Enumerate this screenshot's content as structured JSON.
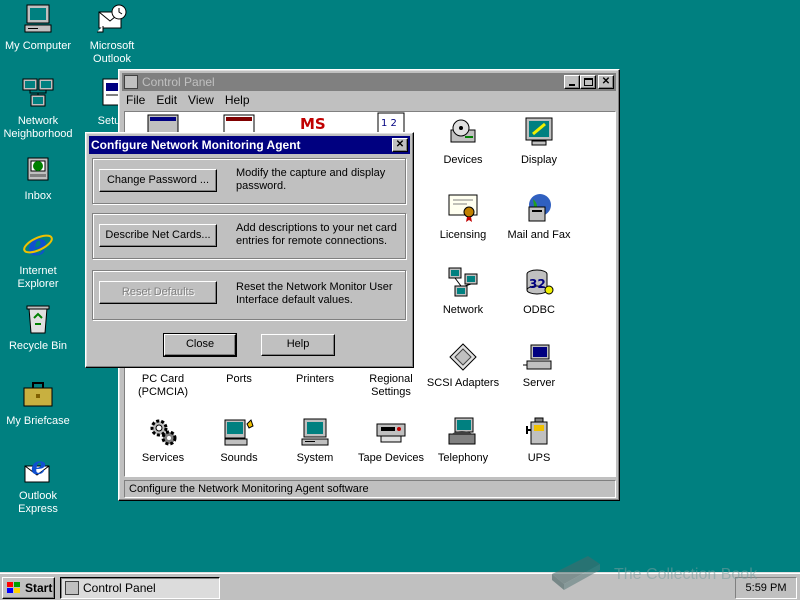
{
  "desktop": {
    "icons": [
      {
        "label": "My Computer"
      },
      {
        "label": "Microsoft Outlook"
      },
      {
        "label": "Network Neighborhood"
      },
      {
        "label": "Setup"
      },
      {
        "label": "Inbox"
      },
      {
        "label": "Internet Explorer"
      },
      {
        "label": "Recycle Bin"
      },
      {
        "label": "My Briefcase"
      },
      {
        "label": "Outlook Express"
      }
    ]
  },
  "control_panel": {
    "title": "Control Panel",
    "menu": [
      "File",
      "Edit",
      "View",
      "Help"
    ],
    "items": [
      {
        "label": "Devices"
      },
      {
        "label": "Display"
      },
      {
        "label": "Licensing"
      },
      {
        "label": "Mail and Fax"
      },
      {
        "label": "Network"
      },
      {
        "label": "ODBC"
      },
      {
        "label": "PC Card (PCMCIA)"
      },
      {
        "label": "Ports"
      },
      {
        "label": "Printers"
      },
      {
        "label": "Regional Settings"
      },
      {
        "label": "SCSI Adapters"
      },
      {
        "label": "Server"
      },
      {
        "label": "Services"
      },
      {
        "label": "Sounds"
      },
      {
        "label": "System"
      },
      {
        "label": "Tape Devices"
      },
      {
        "label": "Telephony"
      },
      {
        "label": "UPS"
      }
    ],
    "status": "Configure the Network Monitoring Agent software"
  },
  "dialog": {
    "title": "Configure Network Monitoring Agent",
    "change_password": {
      "label": "Change Password ...",
      "desc": "Modify the capture and display password."
    },
    "describe_cards": {
      "label": "Describe Net Cards...",
      "desc": "Add descriptions to your net card entries for remote connections."
    },
    "reset_defaults": {
      "label": "Reset Defaults",
      "desc": "Reset the Network Monitor User Interface default values."
    },
    "close_label": "Close",
    "help_label": "Help"
  },
  "taskbar": {
    "start_label": "Start",
    "task_label": "Control Panel",
    "clock": "5:59 PM"
  },
  "watermark": "The Collection Book"
}
